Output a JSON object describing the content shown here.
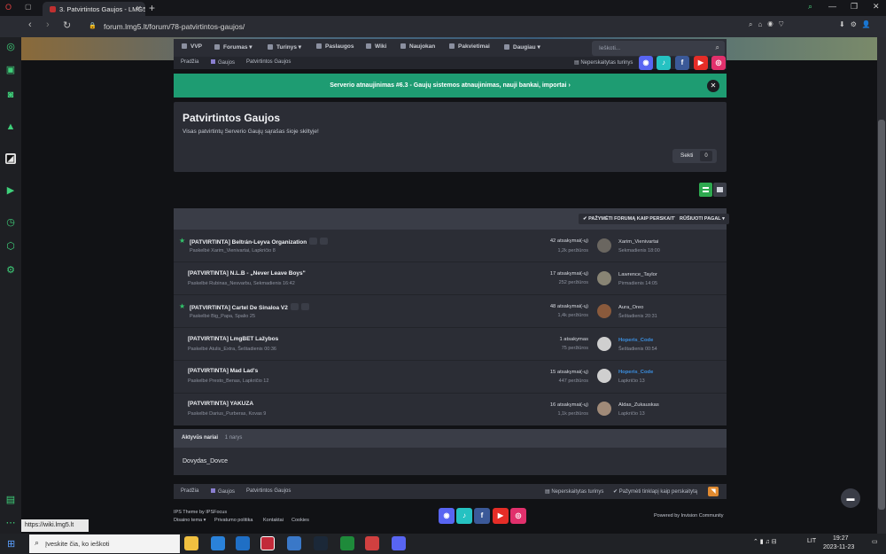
{
  "browser": {
    "tab_title": "3. Patvirtintos Gaujos - LMG5...",
    "url": "forum.lmg5.lt/forum/78-patvirtintos-gaujos/",
    "status_url": "https://wiki.lmg5.lt"
  },
  "nav": {
    "items": [
      "VVP",
      "Forumas",
      "Turinys",
      "Paslaugos",
      "Wiki",
      "Naujokan",
      "Pakvietimai",
      "Daugiau"
    ],
    "search_placeholder": "Ieškoti..."
  },
  "breadcrumb_top": {
    "items": [
      "Pradžia",
      "Gaujos",
      "Patvirtintos Gaujos"
    ],
    "unread_label": "Neperskaitytas turinys"
  },
  "announcement": {
    "text": "Serverio atnaujinimas #6.3 - Gaujų sistemos atnaujinimas, nauji bankai, importai"
  },
  "forum": {
    "title": "Patvirtintos Gaujos",
    "description": "Visas patvirtintų Serverio Gaujų sąrašas šioje skiltyje!",
    "follow_label": "Sekti",
    "follow_count": "0"
  },
  "list_header": {
    "mark_read": "PAŽYMĖTI FORUMĄ KAIP PERSKAITYTĄ",
    "sort": "RŪŠIUOTI PAGAL"
  },
  "topics": [
    {
      "title": "[PATVIRTINTA] Beltrán-Leyva Organization",
      "meta": "Paskelbė Xarim_Vienivartai, Lapkričio 8",
      "replies": "42 atsakymai(-ų)",
      "views": "1,2k peržiūros",
      "last_user": "Xarim_Vienivartai",
      "last_date": "Sekmadienis 18:00"
    },
    {
      "title": "[PATVIRTINTA] N.L.B - „Never Leave Boys\"",
      "meta": "Paskelbė Rubinas_Nesvarbu, Sekmadienis 16:42",
      "replies": "17 atsakymai(-ų)",
      "views": "252 peržiūros",
      "last_user": "Lawrence_Taylor",
      "last_date": "Pirmadienis 14:05"
    },
    {
      "title": "[PATVIRTINTA] Cartel De Sinaloa V2",
      "meta": "Paskelbė Big_Papa, Spalio 25",
      "replies": "48 atsakymai(-ų)",
      "views": "1,4k peržiūros",
      "last_user": "Aura_Oreo",
      "last_date": "Šeštadienis 20:31"
    },
    {
      "title": "[PATVIRTINTA] LmgBET Lažybos",
      "meta": "Paskelbė Atulis_Extra, Šeštadienis 00:36",
      "replies": "1 atsakymas",
      "views": "75 peržiūros",
      "last_user": "Hoperis_Code",
      "last_date": "Šeštadienis 00:54"
    },
    {
      "title": "[PATVIRTINTA] Mad Lad's",
      "meta": "Paskelbė Presto_Benas, Lapkričio 12",
      "replies": "15 atsakymai(-ų)",
      "views": "447 peržiūros",
      "last_user": "Hoperis_Code",
      "last_date": "Lapkričio 13"
    },
    {
      "title": "[PATVIRTINTA] YAKUZA",
      "meta": "Paskelbė Darius_Purberas, Kovas 9",
      "replies": "16 atsakymai(-ų)",
      "views": "1,1k peržiūros",
      "last_user": "Aldas_Zukauskas",
      "last_date": "Lapkričio 13"
    }
  ],
  "active_users": {
    "label": "Aktyvūs nariai",
    "count": "1 narys",
    "names": "Dovydas_Dovce"
  },
  "breadcrumb_bottom": {
    "items": [
      "Pradžia",
      "Gaujos",
      "Patvirtintos Gaujos"
    ],
    "unread_label": "Neperskaitytas turinys",
    "mark_read": "Pažymėti tinklapį kaip perskaitytą"
  },
  "footer": {
    "theme": "IPS Theme by IPSFocus",
    "links": [
      "Disaino tema",
      "Privatumo politika",
      "Kontaktai",
      "Cookies"
    ],
    "powered": "Powered by Invision Community"
  },
  "taskbar": {
    "search_placeholder": "Įveskite čia, ko ieškoti",
    "lang": "LIT",
    "time": "19:27",
    "date": "2023-11-23"
  }
}
